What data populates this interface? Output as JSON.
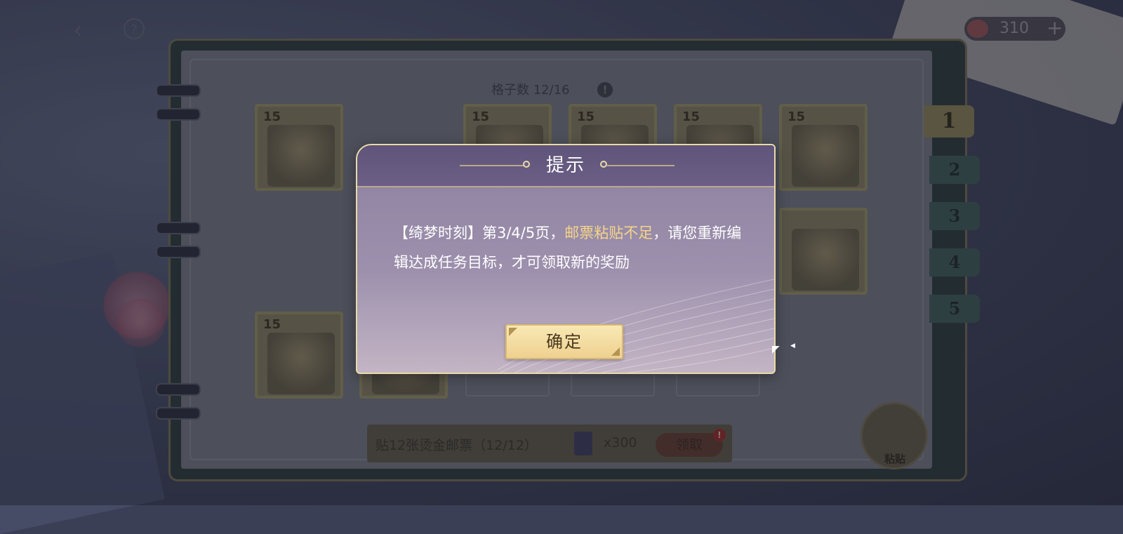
{
  "topbar": {
    "back_icon": "chevron-left-icon",
    "help_label": "?",
    "currency_value": "310",
    "currency_plus": "+"
  },
  "notebook": {
    "grid_count_label": "格子数 12/16",
    "info_label": "!",
    "stamps": [
      {
        "level": "15"
      },
      {
        "level": "15"
      },
      {
        "level": "15"
      },
      {
        "level": "15"
      },
      {
        "level": "15"
      },
      {
        "level": "15"
      }
    ],
    "page_tabs": [
      "1",
      "2",
      "3",
      "4",
      "5"
    ],
    "active_tab": "1",
    "task": {
      "text": "贴12张烫金邮票（12/12）",
      "reward_qty": "x300",
      "claim_label": "领取",
      "badge": "!"
    },
    "paste_label": "粘贴"
  },
  "dialog": {
    "title": "提示",
    "message_part1": "【绮梦时刻】第3/4/5页，",
    "message_highlight": "邮票粘贴不足",
    "message_part2": "，请您重新编辑达成任务目标，才可领取新的奖励",
    "confirm_label": "确定",
    "highlight_color": "#f6d489"
  }
}
